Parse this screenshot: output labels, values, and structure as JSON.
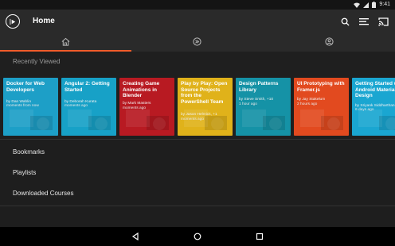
{
  "status": {
    "time": "9:41"
  },
  "appbar": {
    "title": "Home"
  },
  "recent": {
    "title": "Recently Viewed",
    "cards": [
      {
        "title": "Docker for Web Developers",
        "author": "by Dan Wahlin",
        "time": "moments from now",
        "color": "#1d9fc7",
        "progress": 0.0
      },
      {
        "title": "Angular 2: Getting Started",
        "author": "by Deborah Kurata",
        "time": "moments ago",
        "color": "#17a1c7",
        "progress": 0.0
      },
      {
        "title": "Creating Game Animations in Blender",
        "author": "by Mark Masters",
        "time": "moments ago",
        "color": "#b81a22",
        "progress": 0.0
      },
      {
        "title": "Play by Play: Open Source Projects from the PowerShell Team",
        "author": "by Jason Helmick, +1",
        "time": "moments ago",
        "color": "#e0b21a",
        "progress": 0.0
      },
      {
        "title": "Design Patterns Library",
        "author": "by Steve Smith, +10",
        "time": "1 hour ago",
        "color": "#1592a6",
        "progress": 0.0
      },
      {
        "title": "UI Prototyping with Framer.js",
        "author": "by Jay Stakelum",
        "time": "2 hours ago",
        "color": "#e24a1f",
        "progress": 0.0
      },
      {
        "title": "Getting Started with Android Material Design",
        "author": "by Sriyank Siddharthan",
        "time": "6 days ago",
        "color": "#1aa6d1",
        "progress": 0.0
      }
    ]
  },
  "menu": {
    "items": [
      "Bookmarks",
      "Playlists",
      "Downloaded Courses"
    ]
  },
  "colors": {
    "accent": "#f15b2a"
  }
}
